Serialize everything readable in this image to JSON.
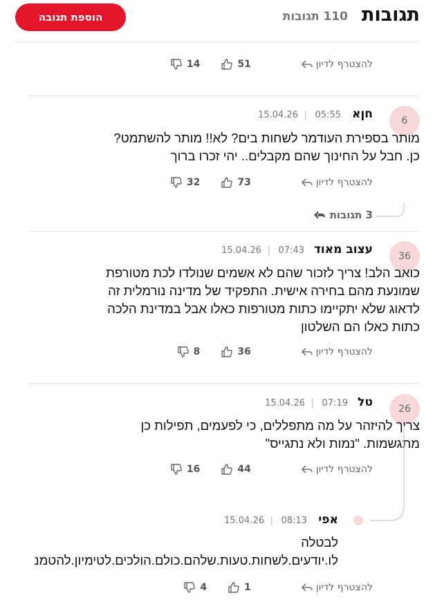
{
  "header": {
    "title": "תגובות",
    "count_label": "110 תגובות",
    "add_button_label": "הוספת תגובה"
  },
  "reply_label": "להצטרף לדיון",
  "top_actions": {
    "likes": "51",
    "dislikes": "14"
  },
  "comments": [
    {
      "avatar": "6",
      "author": "חןא",
      "time": "05:55",
      "date": "15.04.26",
      "lines": [
        "מותר בספירת העודמר לשחות בים? לא!! מותר להשתמט?",
        "כן. חבל על החינוך שהם מקבלים.. יהי זכרו ברוך"
      ],
      "likes": "73",
      "dislikes": "32",
      "replies_label": "3 תגובות"
    },
    {
      "avatar": "36",
      "author": "עצוב מאוד",
      "time": "07:43",
      "date": "15.04.26",
      "lines": [
        "כואב הלב! צריך לזכור שהם לא אשמים שנולדו לכת מטורפת",
        "שמונעת מהם בחירה אישית. התפקיד של מדינה נורמלית זה",
        "לדאוג שלא יתקיימו כתות מטורפות כאלו אבל במדינת הלכה",
        "כתות כאלו הם השלטון"
      ],
      "likes": "36",
      "dislikes": "8"
    },
    {
      "avatar": "26",
      "author": "טל",
      "time": "07:19",
      "date": "15.04.26",
      "lines": [
        "צריך להיזהר על מה מתפללים, כי לפעמים, תפילות כן",
        "מתגשמות. \"נמות ולא נתגייס\""
      ],
      "likes": "44",
      "dislikes": "16"
    }
  ],
  "reply": {
    "author": "אפי",
    "time": "08:13",
    "date": "15.04.26",
    "lines": [
      "לבטלה",
      "לו.יודעים.לשחות.טעות.שלהם.כולם.הולכים.לטימיון.להטמנ"
    ],
    "likes": "1",
    "dislikes": "4"
  },
  "colors": {
    "brand": "#e4152b",
    "avatar_bg": "#f7d8d9",
    "muted": "#777777"
  },
  "icons": [
    "reply-arrow-icon",
    "thumbs-up-icon",
    "thumbs-down-icon",
    "replies-arrow-icon"
  ]
}
